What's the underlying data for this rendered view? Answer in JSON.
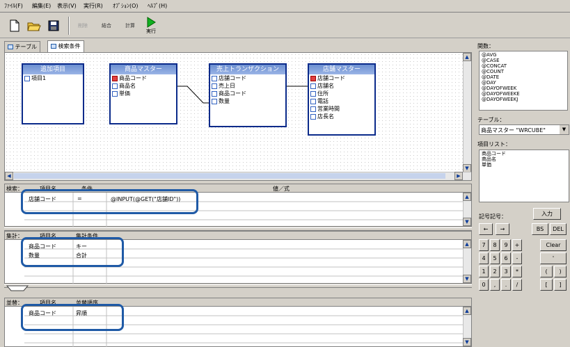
{
  "menu": [
    "ﾌｧｲﾙ(F)",
    "編集(E)",
    "表示(V)",
    "実行(R)",
    "ｵﾌﾟｼｮﾝ(O)",
    "ﾍﾙﾌﾟ(H)"
  ],
  "toolbar": {
    "new_icon": "new-document-icon",
    "open_icon": "open-folder-icon",
    "save_icon": "floppy-icon",
    "btn_delete": "削除",
    "btn_join": "結合",
    "btn_calc": "計算",
    "btn_run": "実行"
  },
  "tabs": [
    "テーブル",
    "検索条件"
  ],
  "tables": [
    {
      "title": "追加項目",
      "fields": [
        {
          "name": "項目1",
          "key": false
        }
      ]
    },
    {
      "title": "商品マスター",
      "fields": [
        {
          "name": "商品コード",
          "key": true
        },
        {
          "name": "商品名",
          "key": false
        },
        {
          "name": "単価",
          "key": false
        }
      ]
    },
    {
      "title": "売上トランザクション",
      "fields": [
        {
          "name": "店舗コード",
          "key": false
        },
        {
          "name": "売上日",
          "key": false
        },
        {
          "name": "商品コード",
          "key": false
        },
        {
          "name": "数量",
          "key": false
        }
      ]
    },
    {
      "title": "店舗マスター",
      "fields": [
        {
          "name": "店舗コード",
          "key": true
        },
        {
          "name": "店舗名",
          "key": false
        },
        {
          "name": "住所",
          "key": false
        },
        {
          "name": "電話",
          "key": false
        },
        {
          "name": "営業時間",
          "key": false
        },
        {
          "name": "店長名",
          "key": false
        }
      ]
    }
  ],
  "search_panel": {
    "label": "検索：",
    "headers": [
      "項目名",
      "条件",
      "値／式"
    ],
    "rows": [
      {
        "field": "店舗コード",
        "cond": "=",
        "value": "@INPUT(@GET(\"店舗ID\"))"
      }
    ]
  },
  "agg_panel": {
    "label": "集計：",
    "headers": [
      "項目名",
      "集計条件"
    ],
    "rows": [
      {
        "field": "商品コード",
        "cond": "キー"
      },
      {
        "field": "数量",
        "cond": "合計"
      }
    ]
  },
  "sort_panel": {
    "label": "並替：",
    "headers": [
      "項目名",
      "並替順序"
    ],
    "rows": [
      {
        "field": "商品コード",
        "cond": "昇順"
      }
    ]
  },
  "right": {
    "functions_label": "関数：",
    "functions": [
      "@AVG",
      "@CASE",
      "@CONCAT",
      "@COUNT",
      "@DATE",
      "@DAY",
      "@DAYOFWEEK",
      "@DAYOFWEEKE",
      "@DAYOFWEEKJ"
    ],
    "table_label": "テーブル：",
    "table_select": "商品マスター \"WRCUBE\"",
    "fields_label": "項目リスト：",
    "fields": [
      "商品コード",
      "商品名",
      "単価"
    ],
    "ops_label": "記号記号：",
    "input_btn": "入力",
    "keys_row1": [
      "←",
      "→",
      "BS",
      "DEL"
    ],
    "keys": [
      "7",
      "8",
      "9",
      "+",
      "Clear",
      "4",
      "5",
      "6",
      "-",
      "'",
      "1",
      "2",
      "3",
      "*",
      "(",
      ")",
      "0",
      ",",
      ".",
      "/",
      "[",
      "]"
    ]
  },
  "colors": {
    "highlight": "#1f5aa6",
    "table_border": "#0a2a8a"
  }
}
